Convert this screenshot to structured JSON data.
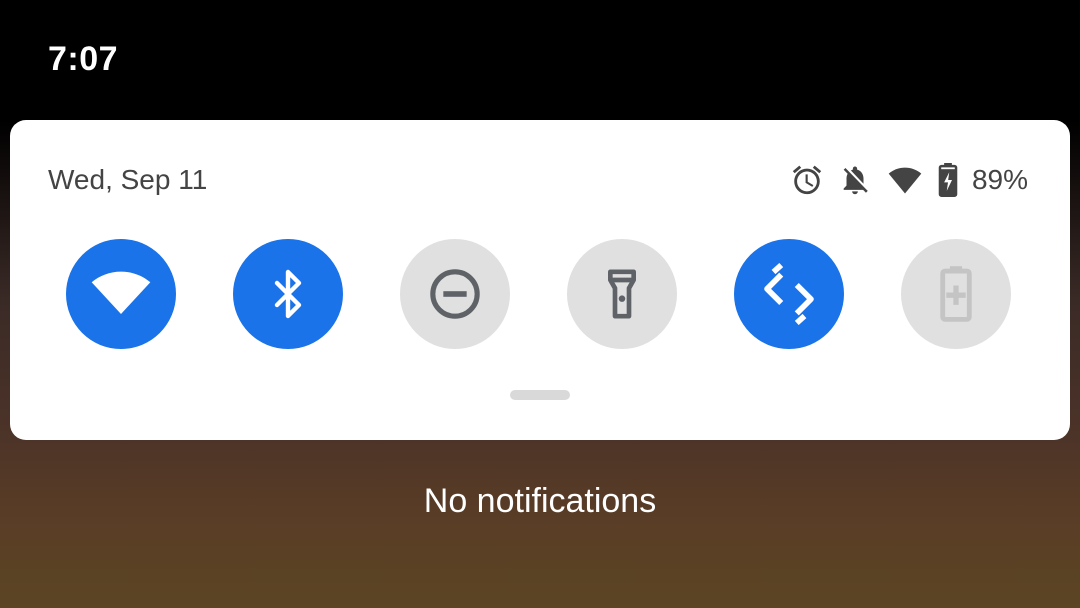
{
  "status_bar": {
    "time": "7:07"
  },
  "quick_settings": {
    "date": "Wed, Sep 11",
    "battery_percent": "89%",
    "status_icons": [
      "alarm-icon",
      "notifications-off-icon",
      "wifi-signal-icon",
      "battery-charging-icon"
    ],
    "tiles": [
      {
        "name": "wifi",
        "icon": "wifi-icon",
        "state": "on"
      },
      {
        "name": "bluetooth",
        "icon": "bluetooth-icon",
        "state": "on"
      },
      {
        "name": "do-not-disturb",
        "icon": "do-not-disturb-icon",
        "state": "off"
      },
      {
        "name": "flashlight",
        "icon": "flashlight-icon",
        "state": "off"
      },
      {
        "name": "auto-rotate",
        "icon": "auto-rotate-icon",
        "state": "on"
      },
      {
        "name": "battery-saver",
        "icon": "battery-saver-icon",
        "state": "unavailable"
      }
    ],
    "colors": {
      "active": "#1a73e8",
      "inactive": "#e0e0e0",
      "icon_inactive": "#5f6368"
    }
  },
  "notifications": {
    "empty_text": "No notifications"
  }
}
